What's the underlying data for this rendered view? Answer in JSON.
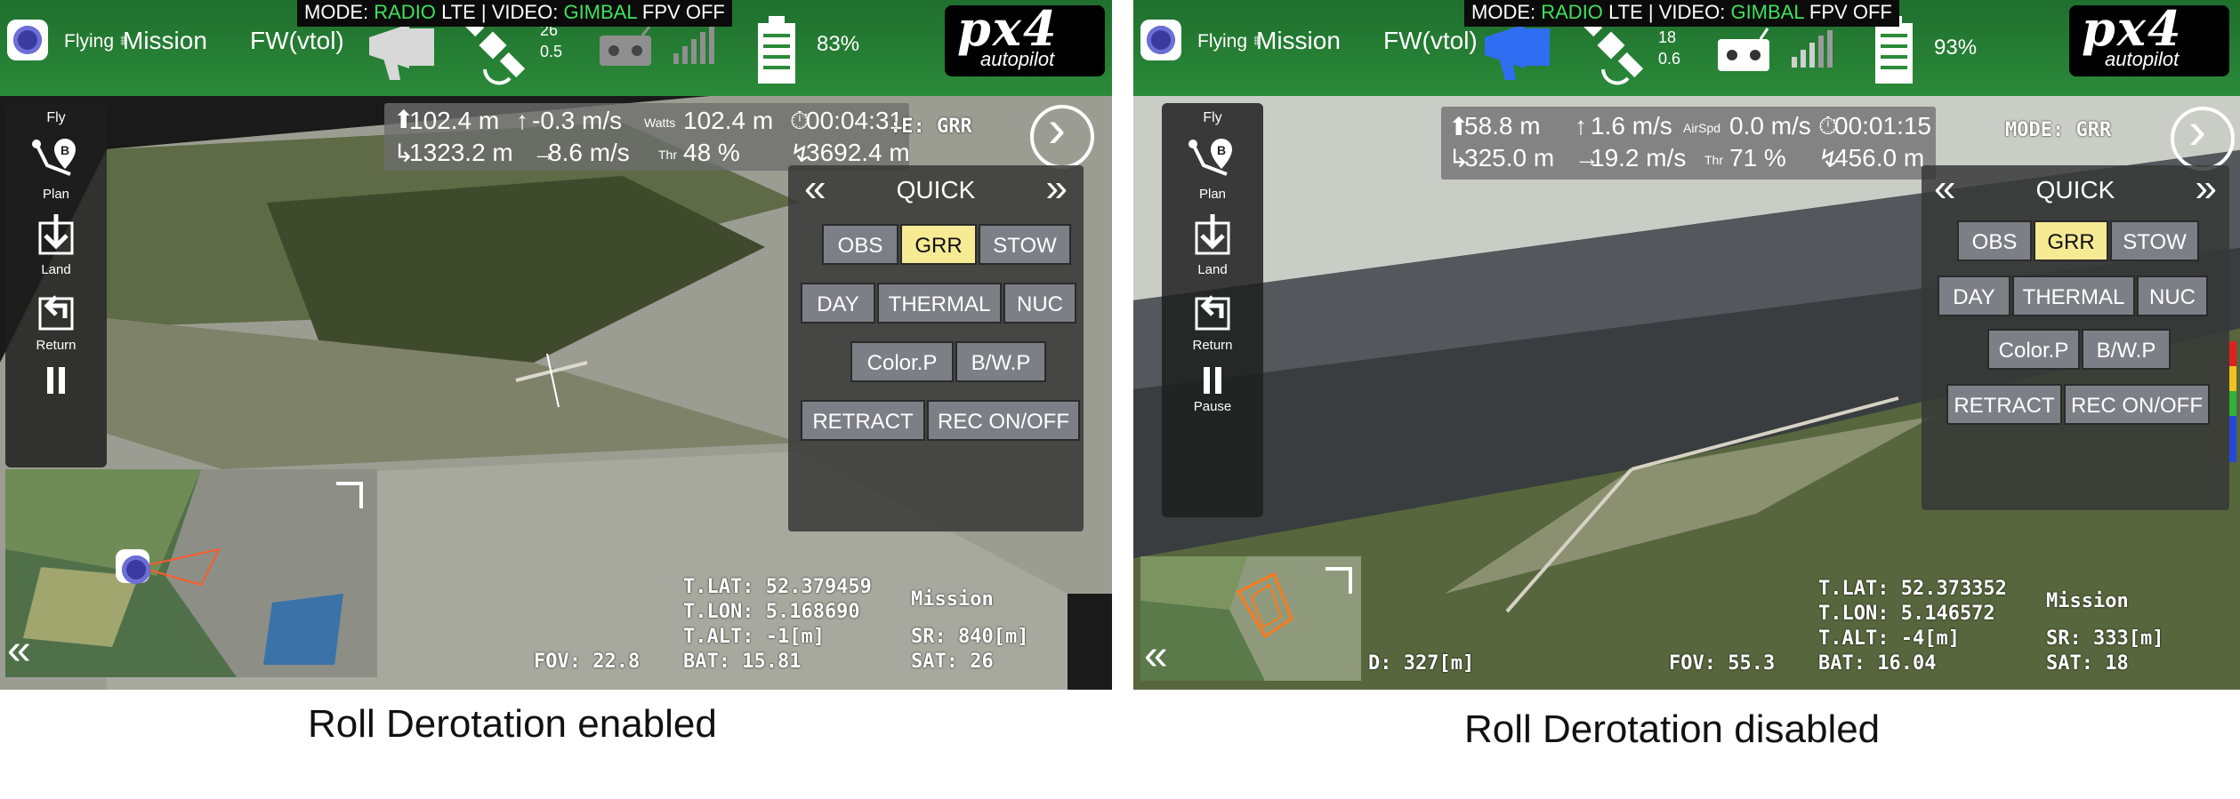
{
  "captions": {
    "left": "Roll Derotation enabled",
    "right": "Roll Derotation disabled"
  },
  "colors": {
    "header_green": "#2b8a39",
    "selected_button": "#f6ea94",
    "button_gray": "#7c7f86",
    "mode_green": "#3de35a"
  },
  "left": {
    "header": {
      "status": "Flying",
      "mission_icon": "waypoint-icon",
      "mission": "Mission",
      "vehicle": "FW(vtol)",
      "battery_pct": "83%",
      "gps_count": "26",
      "gps_hdop": "0.5"
    },
    "modebar": {
      "mode_label": "MODE:",
      "radio": "RADIO",
      "lte": "LTE",
      "sep": "|",
      "video_label": "VIDEO:",
      "gimbal": "GIMBAL",
      "fpv": "FPV",
      "off": "OFF"
    },
    "logo": {
      "px4": "px4",
      "sub": "autopilot"
    },
    "sidebar": {
      "title": "Fly",
      "items": [
        {
          "label": "Plan",
          "icon": "plan-icon"
        },
        {
          "label": "Land",
          "icon": "land-icon"
        },
        {
          "label": "Return",
          "icon": "return-icon"
        },
        {
          "label": "",
          "icon": "pause-icon"
        }
      ]
    },
    "telemetry": {
      "alt": "102.4 m",
      "climb": "-0.3 m/s",
      "watts_label": "Watts",
      "watts": "102.4 m",
      "time": "00:04:31",
      "dist": "1323.2 m",
      "speed": "8.6 m/s",
      "thr_label": "Thr",
      "thr": "48 %",
      "total": "3692.4 m"
    },
    "quick": {
      "title": "QUICK",
      "rows": [
        [
          "OBS",
          "GRR",
          "STOW"
        ],
        [
          "DAY",
          "THERMAL",
          "NUC"
        ],
        [
          "Color.P",
          "B/W.P"
        ],
        [
          "RETRACT",
          "REC ON/OFF"
        ]
      ],
      "selected": "GRR"
    },
    "osd": {
      "mode_top": ":E: GRR",
      "tlat": "T.LAT: 52.379459",
      "tlon": "T.LON: 5.168690",
      "talt": "T.ALT: -1[m]",
      "bat": "BAT: 15.81",
      "fov": "FOV: 22.8",
      "mission": "Mission",
      "sr": "SR: 840[m]",
      "sat": "SAT: 26"
    }
  },
  "right": {
    "header": {
      "status": "Flying",
      "mission_icon": "waypoint-icon",
      "mission": "Mission",
      "vehicle": "FW(vtol)",
      "battery_pct": "93%",
      "gps_count": "18",
      "gps_hdop": "0.6"
    },
    "modebar": {
      "mode_label": "MODE:",
      "radio": "RADIO",
      "lte": "LTE",
      "sep": "|",
      "video_label": "VIDEO:",
      "gimbal": "GIMBAL",
      "fpv": "FPV",
      "off": "OFF"
    },
    "logo": {
      "px4": "px4",
      "sub": "autopilot"
    },
    "sidebar": {
      "title": "Fly",
      "items": [
        {
          "label": "Plan",
          "icon": "plan-icon"
        },
        {
          "label": "Land",
          "icon": "land-icon"
        },
        {
          "label": "Return",
          "icon": "return-icon"
        },
        {
          "label": "Pause",
          "icon": "pause-icon"
        }
      ]
    },
    "telemetry": {
      "alt": "58.8 m",
      "climb": "1.6 m/s",
      "watts_label": "AirSpd",
      "watts": "0.0 m/s",
      "time": "00:01:15",
      "dist": "325.0 m",
      "speed": "19.2 m/s",
      "thr_label": "Thr",
      "thr": "71 %",
      "total": "456.0 m"
    },
    "quick": {
      "title": "QUICK",
      "rows": [
        [
          "OBS",
          "GRR",
          "STOW"
        ],
        [
          "DAY",
          "THERMAL",
          "NUC"
        ],
        [
          "Color.P",
          "B/W.P"
        ],
        [
          "RETRACT",
          "REC ON/OFF"
        ]
      ],
      "selected": "GRR"
    },
    "osd": {
      "mode_top": "MODE: GRR",
      "tlat": "T.LAT: 52.373352",
      "tlon": "T.LON: 5.146572",
      "talt": "T.ALT: -4[m]",
      "bat": "BAT: 16.04",
      "fov": "FOV: 55.3",
      "d": "D: 327[m]",
      "mission": "Mission",
      "sr": "SR: 333[m]",
      "sat": "SAT: 18"
    }
  }
}
